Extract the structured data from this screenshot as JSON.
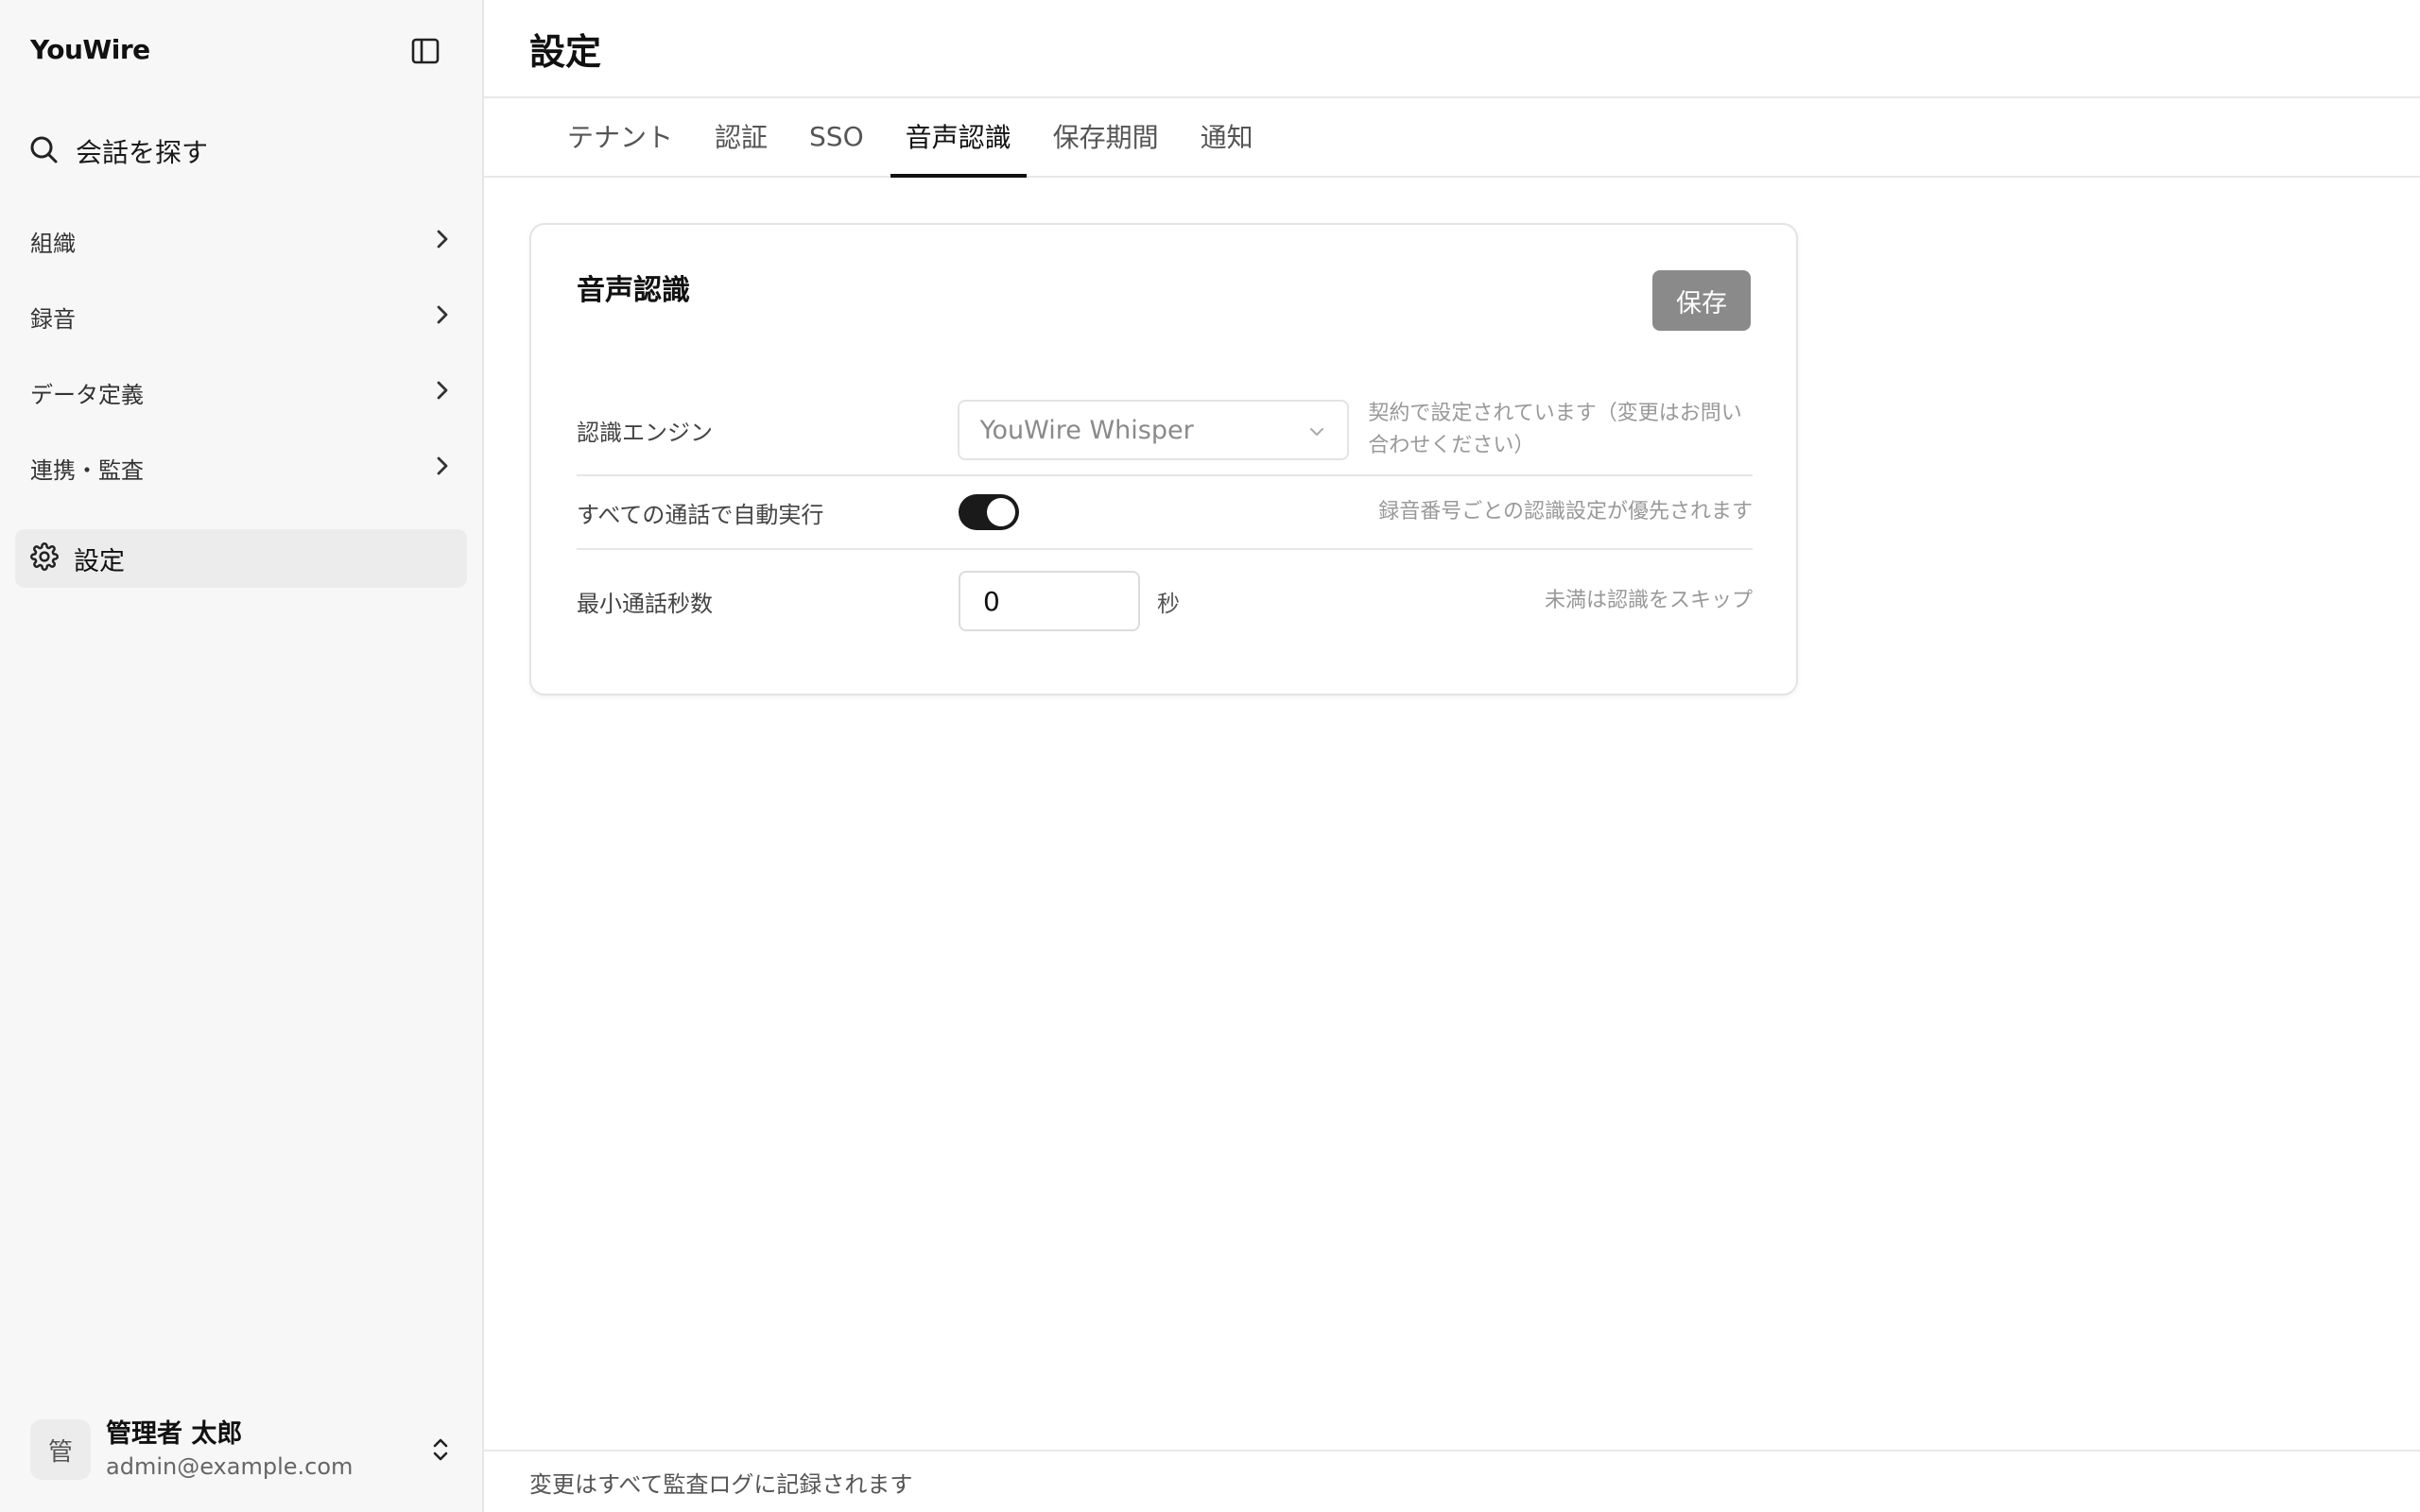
{
  "app": {
    "name": "YouWire"
  },
  "sidebar": {
    "search_label": "会話を探す",
    "items": [
      {
        "label": "組織"
      },
      {
        "label": "録音"
      },
      {
        "label": "データ定義"
      },
      {
        "label": "連携・監査"
      }
    ],
    "settings_label": "設定"
  },
  "user": {
    "avatar": "管",
    "name": "管理者 太郎",
    "email": "admin@example.com"
  },
  "page": {
    "title": "設定"
  },
  "tabs": [
    {
      "label": "テナント",
      "active": false
    },
    {
      "label": "認証",
      "active": false
    },
    {
      "label": "SSO",
      "active": false
    },
    {
      "label": "音声認識",
      "active": true
    },
    {
      "label": "保存期間",
      "active": false
    },
    {
      "label": "通知",
      "active": false
    }
  ],
  "card": {
    "title": "音声認識",
    "save_label": "保存",
    "engine": {
      "label": "認識エンジン",
      "value": "YouWire Whisper",
      "hint": "契約で設定されています（変更はお問い合わせください）"
    },
    "auto_run": {
      "label": "すべての通話で自動実行",
      "enabled": true,
      "hint": "録音番号ごとの認識設定が優先されます"
    },
    "min_seconds": {
      "label": "最小通話秒数",
      "value": "0",
      "unit": "秒",
      "hint": "未満は認識をスキップ"
    }
  },
  "footer": {
    "text": "変更はすべて監査ログに記録されます"
  },
  "colors": {
    "accent": "#111111",
    "save_button": "#8a8a8a",
    "toggle_on": "#1a1a1a"
  }
}
